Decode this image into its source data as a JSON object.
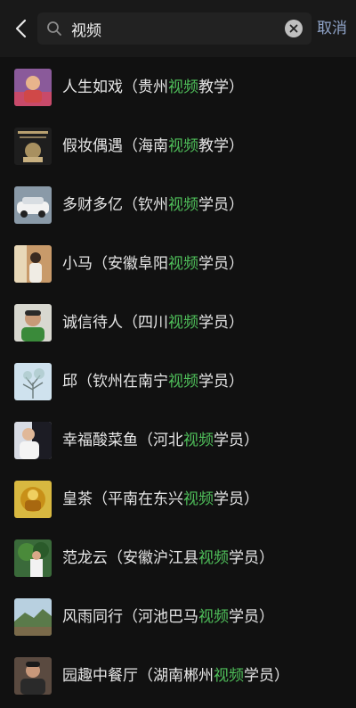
{
  "header": {
    "search_query": "视频",
    "cancel_label": "取消"
  },
  "results": [
    {
      "before": "人生如戏（贵州",
      "highlight": "视频",
      "after": "教学）"
    },
    {
      "before": "假妆偶遇（海南",
      "highlight": "视频",
      "after": "教学）"
    },
    {
      "before": "多财多亿（钦州",
      "highlight": "视频",
      "after": "学员）"
    },
    {
      "before": "小马（安徽阜阳",
      "highlight": "视频",
      "after": "学员）"
    },
    {
      "before": "诚信待人（四川",
      "highlight": "视频",
      "after": "学员）"
    },
    {
      "before": "邱（钦州在南宁",
      "highlight": "视频",
      "after": "学员）"
    },
    {
      "before": "幸福酸菜鱼（河北",
      "highlight": "视频",
      "after": "学员）"
    },
    {
      "before": "皇茶（平南在东兴",
      "highlight": "视频",
      "after": "学员）"
    },
    {
      "before": "范龙云（安徽沪江县",
      "highlight": "视频",
      "after": "学员）"
    },
    {
      "before": "风雨同行（河池巴马",
      "highlight": "视频",
      "after": "学员）"
    },
    {
      "before": "园趣中餐厅（湖南郴州",
      "highlight": "视频",
      "after": "学员）"
    }
  ],
  "colors": {
    "background": "#111111",
    "highlight": "#4fbf5a",
    "cancel": "#8fa3c7"
  }
}
